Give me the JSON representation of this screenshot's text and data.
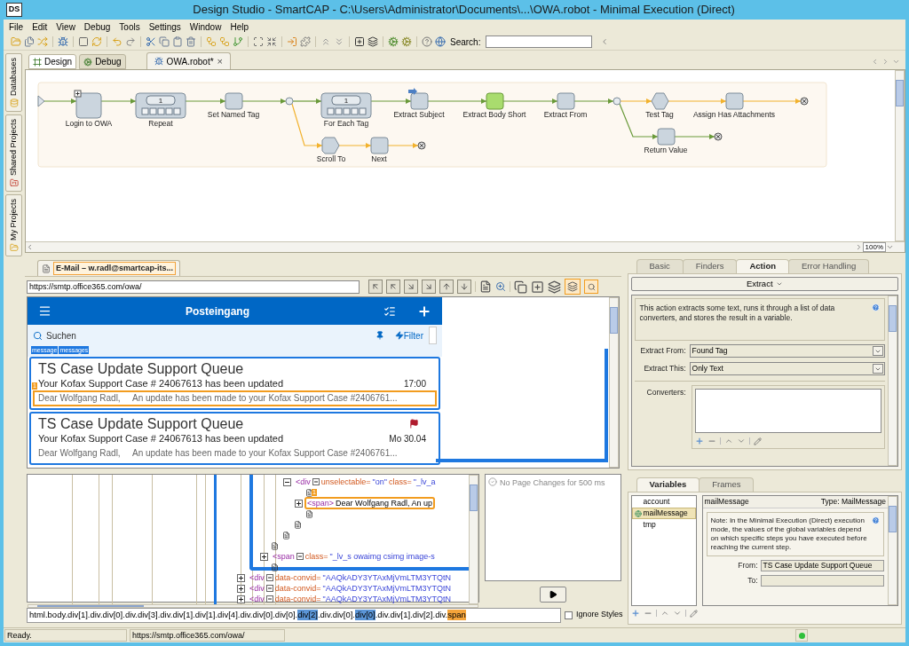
{
  "window": {
    "title": "Design Studio - SmartCAP - C:\\Users\\Administrator\\Documents\\...\\OWA.robot - Minimal Execution (Direct)",
    "logo": "DS"
  },
  "menu": [
    "File",
    "Edit",
    "View",
    "Debug",
    "Tools",
    "Settings",
    "Window",
    "Help"
  ],
  "toolbar": {
    "search_label": "Search:"
  },
  "side_tabs": [
    "Databases",
    "Shared Projects",
    "My Projects"
  ],
  "mode_tabs": [
    {
      "label": "Design",
      "selected": true
    },
    {
      "label": "Debug",
      "selected": false
    }
  ],
  "document_tab": {
    "label": "OWA.robot*",
    "close": "×"
  },
  "workflow": {
    "zoom": "100%",
    "nodes": [
      {
        "label": "Login to OWA",
        "kind": "subroutine",
        "current": false,
        "marked": false
      },
      {
        "label": "Repeat",
        "kind": "loop",
        "iteration": "1",
        "current": false,
        "marked": false
      },
      {
        "label": "Set Named Tag",
        "kind": "step",
        "current": false,
        "marked": false
      },
      {
        "label": "For Each Tag",
        "kind": "loop",
        "iteration": "1",
        "current": false,
        "marked": false
      },
      {
        "label": "Extract Subject",
        "kind": "step",
        "current": false,
        "marked": true
      },
      {
        "label": "Extract Body Short",
        "kind": "step",
        "current": true,
        "marked": false
      },
      {
        "label": "Extract From",
        "kind": "step",
        "current": false,
        "marked": false
      },
      {
        "label": "Test Tag",
        "kind": "condition",
        "current": false,
        "marked": false
      },
      {
        "label": "Assign Has Attachments",
        "kind": "step",
        "current": false,
        "marked": false
      },
      {
        "label": "Scroll To",
        "kind": "try",
        "current": false,
        "marked": false
      },
      {
        "label": "Next",
        "kind": "step",
        "current": false,
        "marked": false
      },
      {
        "label": "Return Value",
        "kind": "step",
        "current": false,
        "marked": false
      }
    ]
  },
  "browser": {
    "tab": "E-Mail – w.radl@smartcap-its...",
    "url": "https://smtp.office365.com/owa/",
    "header_title": "Posteingang",
    "search_placeholder": "Suchen",
    "filter": "Filter",
    "tags": [
      "message",
      "messages"
    ],
    "messages": [
      {
        "subject": "TS Case Update Support Queue",
        "summary": "Your Kofax Support Case # 24067613 has been updated",
        "time": "17:00",
        "preview": "Dear Wolfgang Radl,     An update has been made to your Kofax Support Case #2406761...",
        "flagged": false,
        "highlighted": true,
        "badge": "1"
      },
      {
        "subject": "TS Case Update Support Queue",
        "summary": "Your Kofax Support Case # 24067613 has been updated",
        "time": "Mo 30.04",
        "preview": "Dear Wolfgang Radl,     An update has been made to your Kofax Support Case #2406761...",
        "flagged": true,
        "highlighted": false
      }
    ]
  },
  "dom_tree": [
    {
      "kind": "continued",
      "children": [
        {
          "kind": "continued",
          "children": [
            {
              "kind": "continued",
              "children": [
                {
                  "kind": "continued",
                  "children": [
                    {
                      "kind": "element",
                      "tag": "<div",
                      "attributes": [
                        {
                          "name": "unselectable=",
                          "value": "\"on\""
                        },
                        {
                          "name": "class=",
                          "value": "\"_lv_a"
                        }
                      ],
                      "expanded": true,
                      "selected": false,
                      "children": [
                        {
                          "kind": "text",
                          "badge": "1"
                        },
                        {
                          "kind": "element",
                          "tag": "<span>",
                          "text": "Dear Wolfgang Radl, An up",
                          "expanded": false,
                          "selected": true
                        },
                        {
                          "kind": "text"
                        }
                      ]
                    },
                    {
                      "kind": "text"
                    }
                  ]
                },
                {
                  "kind": "text"
                }
              ]
            },
            {
              "kind": "text"
            },
            {
              "kind": "element",
              "tag": "<span",
              "attributes": [
                {
                  "name": "class=",
                  "value": "\"_lv_s owaimg csimg image-s"
                }
              ],
              "expanded": false,
              "selected": false
            },
            {
              "kind": "text"
            }
          ]
        }
      ]
    },
    {
      "kind": "element",
      "tag": "<div",
      "attributes": [
        {
          "name": "data-convid=",
          "value": "\"AAQkADY3YTAxMjVmLTM3YTQtN"
        }
      ],
      "expanded": false,
      "selected": false
    },
    {
      "kind": "element",
      "tag": "<div",
      "attributes": [
        {
          "name": "data-convid=",
          "value": "\"AAQkADY3YTAxMjVmLTM3YTQtN"
        }
      ],
      "expanded": false,
      "selected": false
    },
    {
      "kind": "element",
      "tag": "<div",
      "attributes": [
        {
          "name": "data-convid=",
          "value": "\"AAQkADY3YTAxMjVmLTM3YTQtN"
        }
      ],
      "expanded": false,
      "selected": false
    }
  ],
  "page_changes": {
    "message": "No Page Changes for 500 ms"
  },
  "tag_path": [
    {
      "text": "html.body.div[1].div.div[0].div.div[3].div.div[1].div[1].div[4].div.div[0].div[0].",
      "kind": "plain"
    },
    {
      "text": "div[2]",
      "kind": "match"
    },
    {
      "text": ".div.div[0].",
      "kind": "plain"
    },
    {
      "text": "div[0]",
      "kind": "match"
    },
    {
      "text": ".div.div[1].div[2].div.",
      "kind": "plain"
    },
    {
      "text": "span",
      "kind": "target"
    }
  ],
  "ignore_styles": {
    "label": "Ignore Styles",
    "checked": false
  },
  "step_panel": {
    "tabs": [
      {
        "label": "Basic",
        "selected": false
      },
      {
        "label": "Finders",
        "selected": false
      },
      {
        "label": "Action",
        "selected": true
      },
      {
        "label": "Error Handling",
        "selected": false
      }
    ],
    "action": "Extract",
    "description": "This action extracts some text, runs it through a list of data converters, and stores the result in a variable.",
    "fields": [
      {
        "label": "Extract From:",
        "value": "Found Tag"
      },
      {
        "label": "Extract This:",
        "value": "Only Text"
      }
    ],
    "converters_label": "Converters:"
  },
  "variables_panel": {
    "tabs": [
      {
        "label": "Variables",
        "selected": true
      },
      {
        "label": "Frames",
        "selected": false
      }
    ],
    "variables": [
      {
        "name": "account",
        "selected": false
      },
      {
        "name": "mailMessage",
        "selected": true
      },
      {
        "name": "tmp",
        "selected": false
      }
    ],
    "detail": {
      "name": "mailMessage",
      "type": "Type: MailMessage",
      "note": "Note: In the Minimal Execution (Direct) execution mode, the values of the global variables depend on which specific steps you have executed before reaching the current step.",
      "fields": [
        {
          "label": "From:",
          "value": "TS Case Update Support Queue"
        },
        {
          "label": "To:"
        }
      ]
    }
  },
  "status_bar": {
    "message": "Ready.",
    "url": "https://smtp.office365.com/owa/"
  }
}
